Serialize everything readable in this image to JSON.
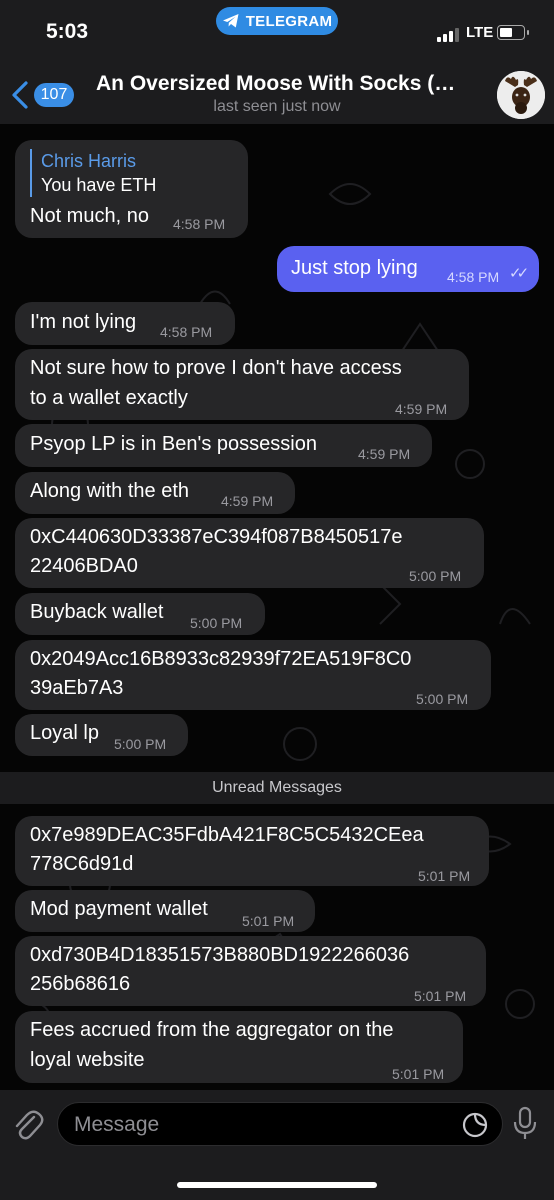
{
  "status_bar": {
    "time": "5:03",
    "app_pill": "TELEGRAM",
    "network": "LTE"
  },
  "header": {
    "back_count": "107",
    "title": "An Oversized Moose With Socks (…",
    "subtitle": "last seen just now"
  },
  "messages": [
    {
      "reply_name": "Chris Harris",
      "reply_text": "You have ETH",
      "text": "Not much, no",
      "time": "4:58 PM"
    },
    {
      "text": "Just stop lying",
      "time": "4:58 PM",
      "checks": "✓✓"
    },
    {
      "text": "I'm not lying",
      "time": "4:58 PM"
    },
    {
      "line1": "Not sure how to prove I don't have access",
      "line2": "to a wallet exactly",
      "time": "4:59 PM"
    },
    {
      "text": "Psyop LP is in Ben's possession",
      "time": "4:59 PM"
    },
    {
      "text": "Along with the eth",
      "time": "4:59 PM"
    },
    {
      "line1": "0xC440630D33387eC394f087B8450517e",
      "line2": "22406BDA0",
      "time": "5:00 PM"
    },
    {
      "text": "Buyback wallet",
      "time": "5:00 PM"
    },
    {
      "line1": "0x2049Acc16B8933c82939f72EA519F8C0",
      "line2": "39aEb7A3",
      "time": "5:00 PM"
    },
    {
      "text": "Loyal lp",
      "time": "5:00 PM"
    },
    {
      "line1": "0x7e989DEAC35FdbA421F8C5C5432CEea",
      "line2": "778C6d91d",
      "time": "5:01 PM"
    },
    {
      "text": "Mod payment wallet",
      "time": "5:01 PM"
    },
    {
      "line1": "0xd730B4D18351573B880BD1922266036",
      "line2": "256b68616",
      "time": "5:01 PM"
    },
    {
      "line1": "Fees accrued from the aggregator on the",
      "line2": "loyal website",
      "time": "5:01 PM"
    }
  ],
  "unread_divider": "Unread Messages",
  "input": {
    "placeholder": "Message"
  }
}
